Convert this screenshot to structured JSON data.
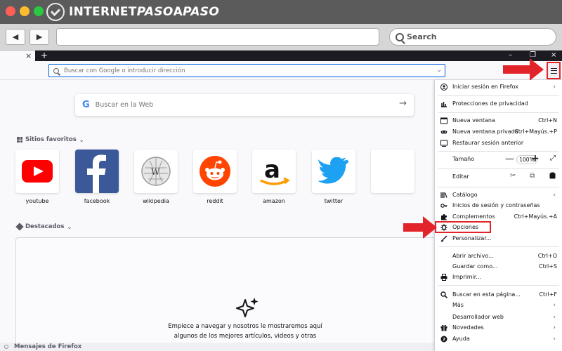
{
  "site_brand": {
    "prefix": "INTERNET",
    "accent": "PASO",
    "middle": "A",
    "suffix": "PASO"
  },
  "mac_toolbar": {
    "back_glyph": "◀",
    "forward_glyph": "▶",
    "search_label": "Search"
  },
  "firefox": {
    "tab_close_glyph": "×",
    "new_tab_glyph": "+",
    "window_controls": {
      "minimize": "–",
      "maximize": "❐",
      "close": "×"
    },
    "urlbar": {
      "placeholder": "Buscar con Google o introducir dirección",
      "dropdown_glyph": "⌄"
    },
    "menu_button_icon": "hamburger-icon"
  },
  "newtab": {
    "search_placeholder": "Buscar en la Web",
    "search_go_glyph": "→",
    "google_logo": "G",
    "top_sites_title": "Sitios favoritos",
    "top_sites": [
      {
        "label": "youtube",
        "icon": "youtube-icon"
      },
      {
        "label": "facebook",
        "icon": "facebook-icon"
      },
      {
        "label": "wikipedia",
        "icon": "wikipedia-icon"
      },
      {
        "label": "reddit",
        "icon": "reddit-icon"
      },
      {
        "label": "amazon",
        "icon": "amazon-icon"
      },
      {
        "label": "twitter",
        "icon": "twitter-icon"
      }
    ],
    "highlights_title": "Destacados",
    "highlights_message": "Empiece a navegar y nosotros le mostraremos aquí algunos de los mejores artículos, videos y otras páginas",
    "messages_title": "Mensajes de Firefox"
  },
  "menu": {
    "sign_in": "Iniciar sesión en Firefox",
    "privacy": "Protecciones de privacidad",
    "new_window": {
      "label": "Nueva ventana",
      "shortcut": "Ctrl+N"
    },
    "new_private_window": {
      "label": "Nueva ventana privada",
      "shortcut": "Ctrl+Mayús.+P"
    },
    "restore_session": "Restaurar sesión anterior",
    "zoom": {
      "label": "Tamaño",
      "minus": "—",
      "value": "100%",
      "plus": "+",
      "fullscreen": "⤢"
    },
    "edit": {
      "label": "Editar",
      "cut": "✂",
      "copy": "⧉",
      "paste": "📋"
    },
    "library": "Catálogo",
    "logins": "Inicios de sesión y contraseñas",
    "addons": {
      "label": "Complementos",
      "shortcut": "Ctrl+Mayús.+A"
    },
    "options": "Opciones",
    "customize": "Personalizar...",
    "open_file": {
      "label": "Abrir archivo...",
      "shortcut": "Ctrl+O"
    },
    "save_as": {
      "label": "Guardar como...",
      "shortcut": "Ctrl+S"
    },
    "print": "Imprimir...",
    "find": {
      "label": "Buscar en esta página...",
      "shortcut": "Ctrl+F"
    },
    "more": "Más",
    "web_developer": "Desarrollador web",
    "whats_new": "Novedades",
    "help": "Ayuda",
    "chevron": "›"
  },
  "colors": {
    "highlight_red": "#e2242a",
    "accent_blue": "#0060df",
    "tabstrip_dark": "#1c1b22"
  }
}
